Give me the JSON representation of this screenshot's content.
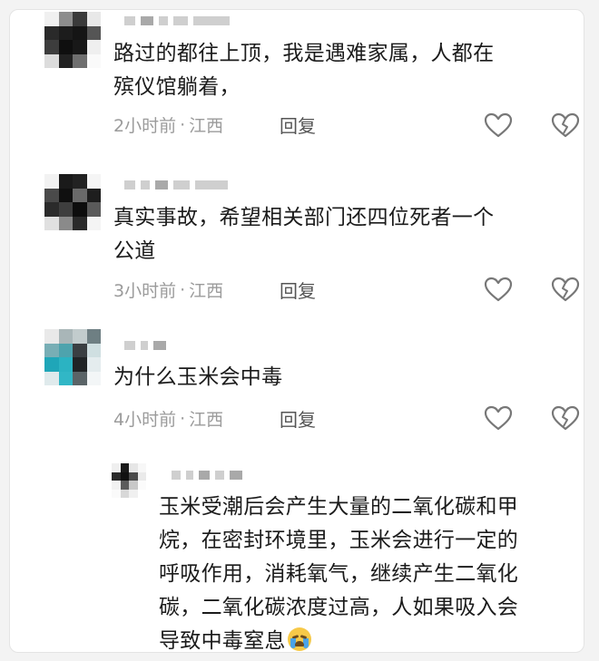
{
  "comments": [
    {
      "text_line1": "路过的都往上顶，我是遇难家属，人都在",
      "text_line2": "殡仪馆躺着，",
      "time": "2小时前",
      "region": "江西",
      "reply_label": "回复"
    },
    {
      "text_line1": "真实事故，希望相关部门还四位死者一个",
      "text_line2": "公道",
      "time": "3小时前",
      "region": "江西",
      "reply_label": "回复"
    },
    {
      "text_line1": "为什么玉米会中毒",
      "time": "4小时前",
      "region": "江西",
      "reply_label": "回复"
    }
  ],
  "reply": {
    "line1": "玉米受潮后会产生大量的二氧化碳和甲",
    "line2": "烷，在密封环境里，玉米会进行一定的",
    "line3": "呼吸作用，消耗氧气，继续产生二氧化",
    "line4": "碳，二氧化碳浓度过高，人如果吸入会",
    "line5": "导致中毒窒息"
  },
  "meta_separator": "·",
  "icons": {
    "like": "heart-outline-icon",
    "dislike": "broken-heart-icon",
    "emoji": "crying-face-emoji"
  },
  "colors": {
    "text": "#1b1b1b",
    "meta": "#9b9b9b",
    "icon": "#777777"
  }
}
